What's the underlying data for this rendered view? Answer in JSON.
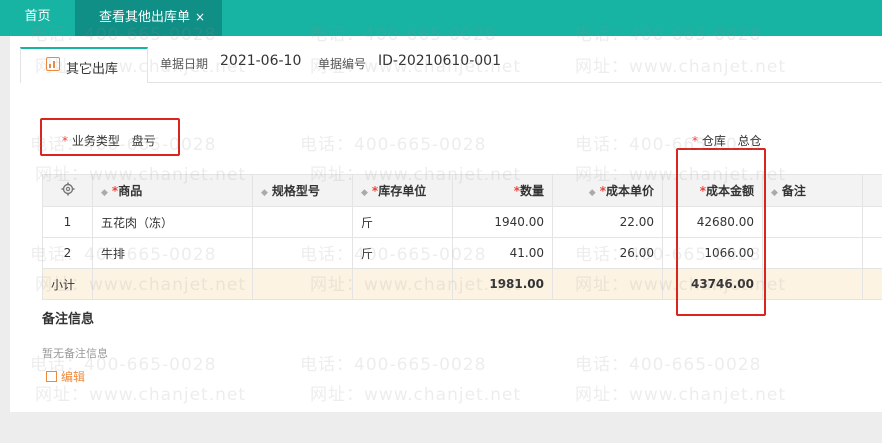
{
  "tabs": {
    "home": "首页",
    "active": "查看其他出库单",
    "close_glyph": "×"
  },
  "doc": {
    "tab_label": "其它出库",
    "date_label": "单据日期",
    "date_value": "2021-06-10",
    "no_label": "单据编号",
    "no_value": "ID-20210610-001",
    "biz_type_label": "业务类型",
    "biz_type_value": "盘亏",
    "warehouse_label": "仓库",
    "warehouse_value": "总仓",
    "required_mark": "*"
  },
  "table": {
    "headers": {
      "product": "商品",
      "spec": "规格型号",
      "unit": "库存单位",
      "qty": "数量",
      "unit_cost": "成本单价",
      "cost_amount": "成本金额",
      "remark": "备注"
    },
    "rows": [
      {
        "idx": "1",
        "product": "五花肉（冻）",
        "spec": "",
        "unit": "斤",
        "qty": "1940.00",
        "unit_cost": "22.00",
        "cost_amount": "42680.00",
        "remark": ""
      },
      {
        "idx": "2",
        "product": "牛排",
        "spec": "",
        "unit": "斤",
        "qty": "41.00",
        "unit_cost": "26.00",
        "cost_amount": "1066.00",
        "remark": ""
      }
    ],
    "subtotal": {
      "label": "小计",
      "qty": "1981.00",
      "cost_amount": "43746.00"
    }
  },
  "remark": {
    "title": "备注信息",
    "empty_text": "暂无备注信息",
    "edit_label": "编辑"
  },
  "watermark": {
    "phone": "电话：400-665-0028",
    "site": "网址：www.chanjet.net"
  },
  "colors": {
    "brand": "#17b3a3",
    "brand_dark": "#0f8f85",
    "accent": "#f08a3b",
    "required": "#e8453c",
    "highlight_box": "#d9251d",
    "subtotal_bg": "#fdf3e3"
  },
  "icons": {
    "settings": "gear-icon",
    "doc_tab": "chart-doc-icon",
    "edit": "edit-icon",
    "sort": "sort-icon"
  }
}
